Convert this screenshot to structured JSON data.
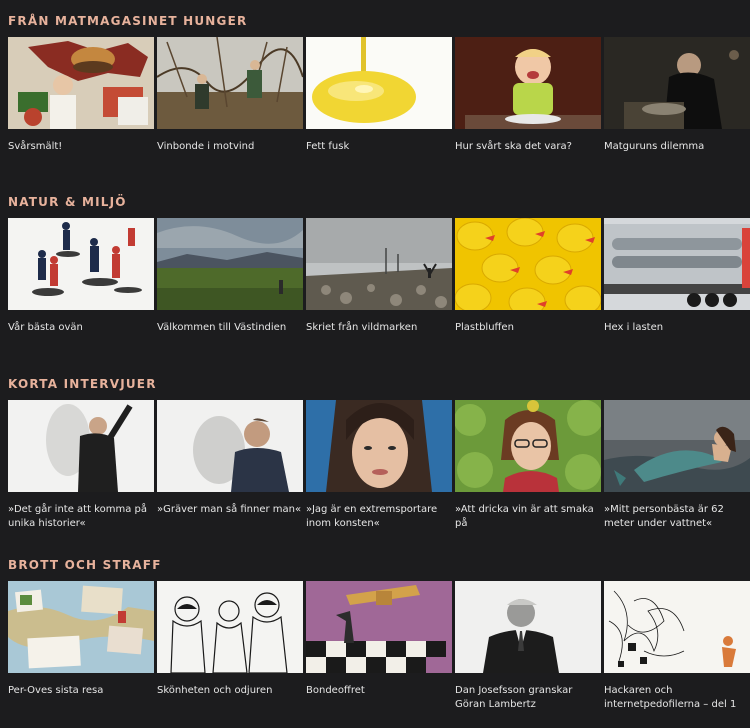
{
  "sections": [
    {
      "title": "FRÅN MATMAGASINET HUNGER",
      "items": [
        {
          "caption": "Svårsmält!"
        },
        {
          "caption": "Vinbonde i motvind"
        },
        {
          "caption": "Fett fusk"
        },
        {
          "caption": "Hur svårt ska det vara?"
        },
        {
          "caption": "Matguruns dilemma"
        }
      ]
    },
    {
      "title": "NATUR & MILJÖ",
      "items": [
        {
          "caption": "Vår bästa ovän"
        },
        {
          "caption": "Välkommen till Västindien"
        },
        {
          "caption": "Skriet från vildmarken"
        },
        {
          "caption": "Plastbluffen"
        },
        {
          "caption": "Hex i lasten"
        }
      ]
    },
    {
      "title": "KORTA INTERVJUER",
      "items": [
        {
          "caption": "»Det går inte att komma på unika historier«"
        },
        {
          "caption": "»Gräver man så finner man«"
        },
        {
          "caption": "»Jag är en extremsportare inom konsten«"
        },
        {
          "caption": "»Att dricka vin är att smaka på"
        },
        {
          "caption": "»Mitt personbästa är 62 meter under vattnet«"
        }
      ]
    },
    {
      "title": "BROTT OCH STRAFF",
      "items": [
        {
          "caption": "Per-Oves sista resa"
        },
        {
          "caption": "Skönheten och odjuren"
        },
        {
          "caption": "Bondeoffret"
        },
        {
          "caption": "Dan Josefsson granskar Göran Lambertz"
        },
        {
          "caption": "Hackaren och internetpedofilerna – del 1"
        }
      ]
    }
  ]
}
